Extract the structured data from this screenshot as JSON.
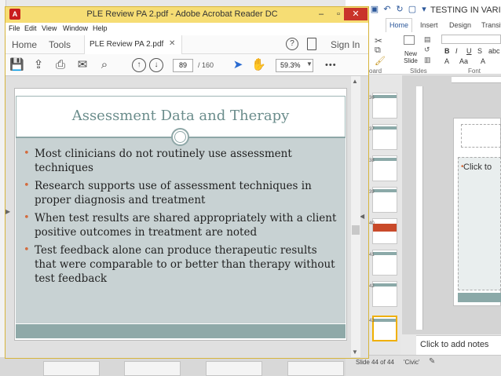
{
  "acrobat": {
    "window_title": "PLE Review PA 2.pdf - Adobe Acrobat Reader DC",
    "menu": [
      "File",
      "Edit",
      "View",
      "Window",
      "Help"
    ],
    "toolbar": {
      "home_label": "Home",
      "tools_label": "Tools",
      "doc_tab_label": "PLE Review PA 2.pdf",
      "sign_in_label": "Sign In",
      "help_glyph": "?",
      "page_current": "89",
      "page_total": "/ 160",
      "zoom": "59.3%",
      "more_glyph": "•••"
    },
    "icons": [
      "save-icon",
      "upload-icon",
      "print-icon",
      "email-icon",
      "search-icon",
      "prev-page-icon",
      "next-page-icon",
      "select-cursor-icon",
      "hand-icon"
    ]
  },
  "slide": {
    "title": "Assessment Data and Therapy",
    "bullets": [
      "Most clinicians do not routinely use assessment techniques",
      "Research supports use of assessment techniques in proper diagnosis and treatment",
      "When test results are shared appropriately with a client positive outcomes in treatment are noted",
      "Test feedback alone can produce therapeutic results that were comparable to or better than therapy without test feedback"
    ]
  },
  "powerpoint": {
    "title": "TESTING IN VARIOU",
    "tabs": [
      "Home",
      "Insert",
      "Design",
      "Transit"
    ],
    "ribbon_groups": [
      "oard",
      "Slides",
      "Font"
    ],
    "new_slide_label": "New Slide",
    "thumb_numbers": [
      "36",
      "37",
      "38",
      "39",
      "40",
      "41",
      "42",
      "43",
      "44"
    ],
    "slide_placeholder": "Click to",
    "notes_placeholder": "Click to add notes",
    "status_slide": "Slide 44 of 44",
    "status_theme": "'Civic'"
  },
  "colors": {
    "acrobat_frame": "#f5d86e",
    "slide_accent": "#8ea7a7",
    "slide_title": "#6b8d8c",
    "slide_body_bg": "#c8d2d3",
    "bullet": "#d36b3d",
    "close_button": "#c9342a"
  }
}
